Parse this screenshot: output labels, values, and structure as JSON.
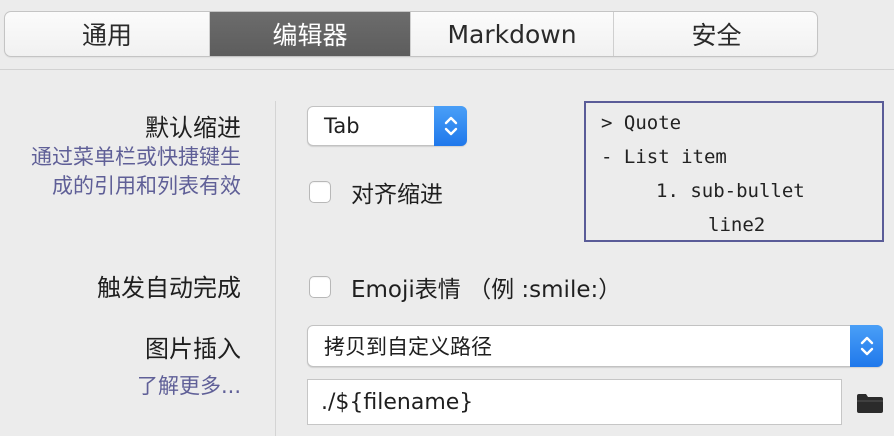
{
  "tabs": [
    {
      "label": "通用",
      "active": false
    },
    {
      "label": "编辑器",
      "active": true
    },
    {
      "label": "Markdown",
      "active": false
    },
    {
      "label": "安全",
      "active": false
    }
  ],
  "indent": {
    "label": "默认缩进",
    "hint_line1": "通过菜单栏或快捷键生",
    "hint_line2": "成的引用和列表有效",
    "select_value": "Tab",
    "align_checkbox_label": "对齐缩进",
    "align_checked": false
  },
  "preview": {
    "line1": "> Quote",
    "line2": "- List item",
    "line3": "1. sub-bullet",
    "line4": "line2"
  },
  "autocomplete": {
    "label": "触发自动完成",
    "emoji_label": "Emoji表情 （例 :smile:）",
    "emoji_checked": false
  },
  "image_insert": {
    "label": "图片插入",
    "learn_more": "了解更多...",
    "select_value": "拷贝到自定义路径",
    "path_value": "./${filename}"
  },
  "colors": {
    "accent": "#1f78eb",
    "hint_text": "#5f5f97",
    "active_tab": "#616161",
    "preview_border": "#5a5c98"
  }
}
